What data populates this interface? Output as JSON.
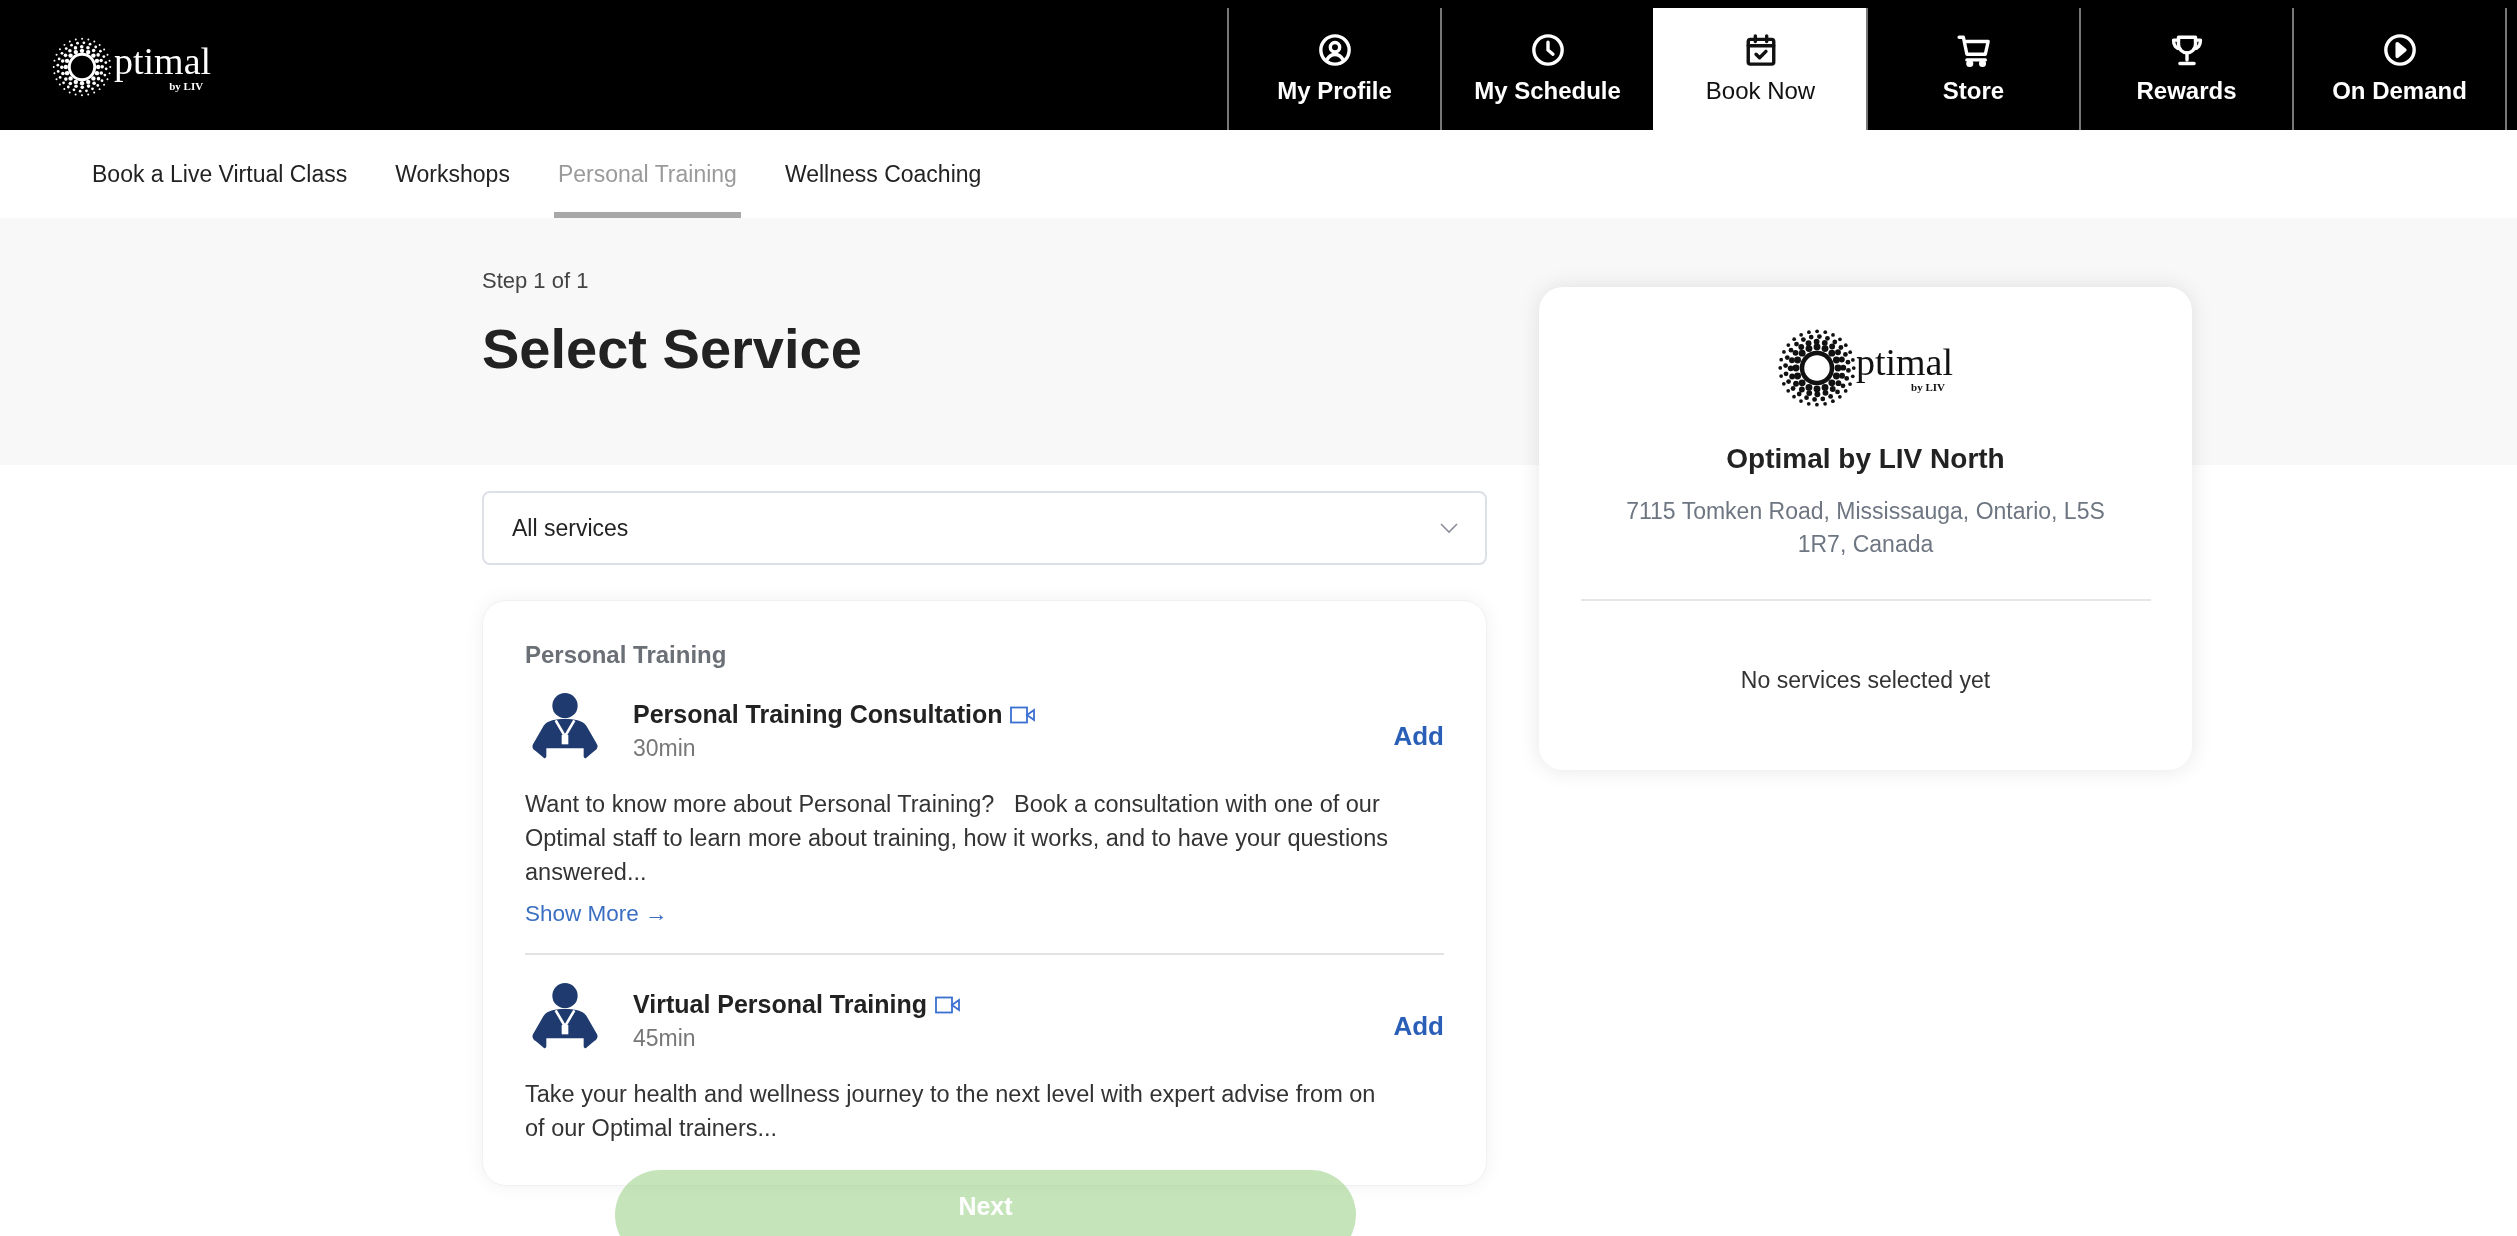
{
  "logo": {
    "wordmark": "ptimal",
    "tagline": "by LIV"
  },
  "nav": [
    {
      "label": "My Profile",
      "kind": "profile",
      "selected": false
    },
    {
      "label": "My Schedule",
      "kind": "clock",
      "selected": false
    },
    {
      "label": "Book Now",
      "kind": "calendar",
      "selected": true
    },
    {
      "label": "Store",
      "kind": "cart",
      "selected": false
    },
    {
      "label": "Rewards",
      "kind": "trophy",
      "selected": false
    },
    {
      "label": "On Demand",
      "kind": "play",
      "selected": false
    }
  ],
  "subnav": [
    {
      "label": "Book a Live Virtual Class",
      "selected": false
    },
    {
      "label": "Workshops",
      "selected": false
    },
    {
      "label": "Personal Training",
      "selected": true
    },
    {
      "label": "Wellness Coaching",
      "selected": false
    }
  ],
  "step": "Step 1 of 1",
  "title": "Select Service",
  "filter": {
    "value": "All services"
  },
  "service_group": {
    "heading": "Personal Training",
    "items": [
      {
        "name": "Personal Training Consultation",
        "virtual": true,
        "duration": "30min",
        "action": "Add",
        "description": "Want to know more about Personal Training?   Book a consultation with one of our Optimal staff to learn more about training, how it works, and to have your questions answered...",
        "show_more": "Show More →"
      },
      {
        "name": "Virtual Personal Training",
        "virtual": true,
        "duration": "45min",
        "action": "Add",
        "description": "Take your health and wellness journey to the next level with expert advise from on of our Optimal trainers..."
      }
    ]
  },
  "location": {
    "logo": {
      "wordmark": "ptimal",
      "tagline": "by LIV"
    },
    "name": "Optimal by LIV North",
    "address": "7115 Tomken Road, Mississauga, Ontario, L5S 1R7, Canada",
    "summary": "No services selected yet"
  },
  "next_button": "Next"
}
